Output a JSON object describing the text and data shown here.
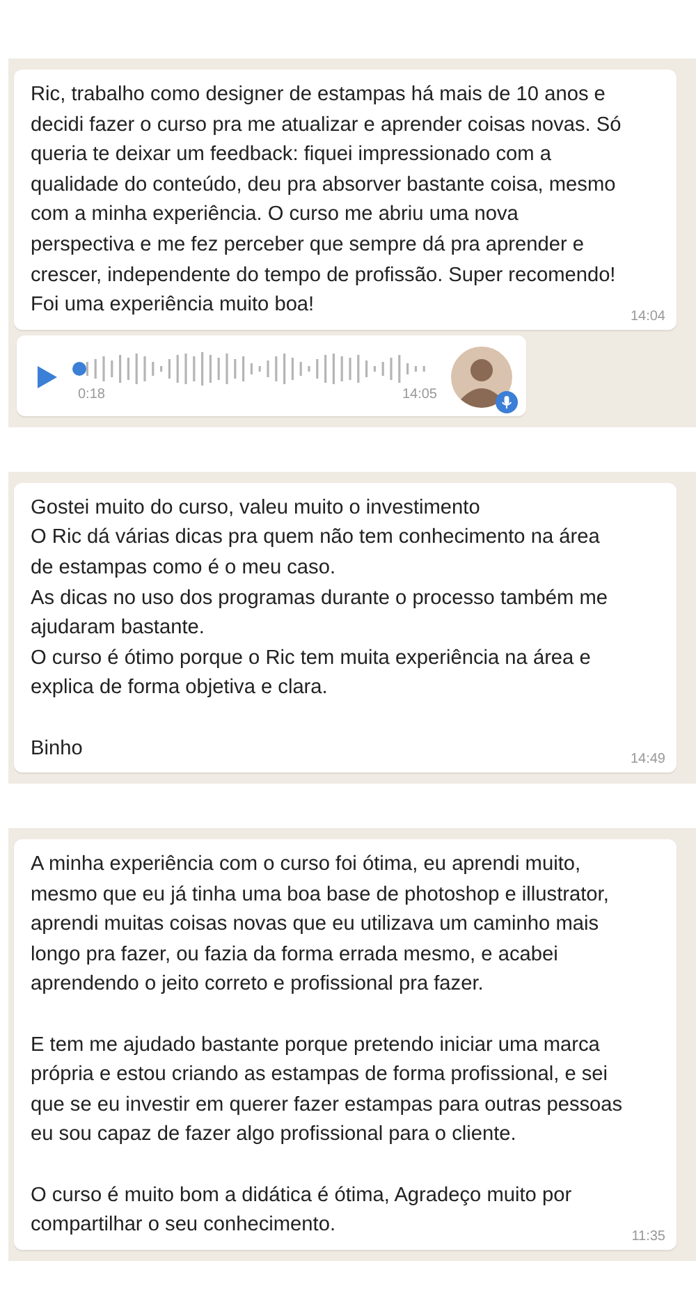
{
  "chats": [
    {
      "messages": [
        {
          "kind": "text",
          "text": "Ric, trabalho como designer de estampas há mais de 10 anos e decidi fazer o curso pra me atualizar e aprender coisas novas. Só queria te deixar um feedback: fiquei impressionado com a qualidade do conteúdo, deu pra absorver bastante coisa, mesmo com a minha experiência. O curso me abriu uma nova perspectiva e me fez perceber que sempre dá pra aprender e crescer, independente do tempo de profissão. Super recomendo! Foi uma experiência muito boa!",
          "time": "14:04"
        },
        {
          "kind": "voice",
          "duration": "0:18",
          "time": "14:05"
        }
      ]
    },
    {
      "messages": [
        {
          "kind": "text",
          "text": "Gostei muito do curso, valeu muito o investimento\nO Ric dá várias dicas pra quem não tem conhecimento na área de estampas como é o meu caso.\nAs dicas no uso dos programas durante o processo também me ajudaram bastante.\nO curso é ótimo porque o Ric tem muita experiência na área e explica de forma objetiva e clara.\n\nBinho",
          "time": "14:49"
        }
      ]
    },
    {
      "messages": [
        {
          "kind": "text",
          "text": "A minha experiência com o curso foi ótima, eu aprendi muito, mesmo que eu já tinha uma boa base de photoshop e illustrator, aprendi muitas coisas novas que eu utilizava um caminho mais longo pra fazer, ou fazia da forma errada mesmo, e acabei aprendendo o jeito correto e profissional pra fazer.\n\nE tem me ajudado bastante porque pretendo iniciar uma marca própria e estou criando as estampas  de forma profissional, e sei que se eu investir em querer fazer estampas para outras pessoas eu sou capaz de fazer algo profissional para o cliente.\n\nO curso é muito bom a didática é ótima, Agradeço muito por compartilhar o seu conhecimento.",
          "time": "11:35"
        }
      ]
    }
  ]
}
